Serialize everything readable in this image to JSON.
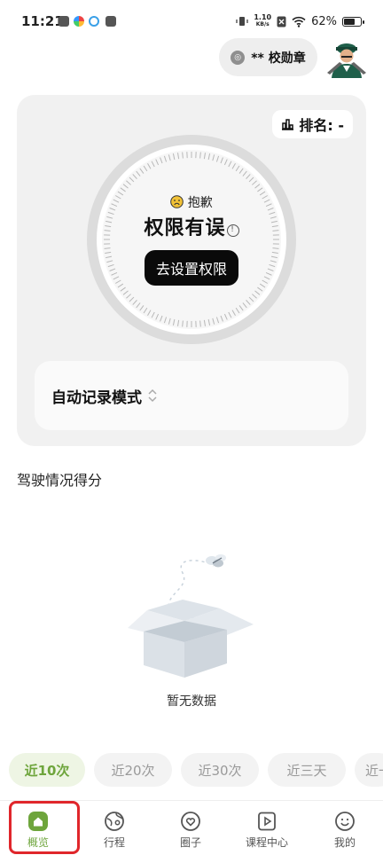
{
  "status_bar": {
    "time": "11:21",
    "net_speed_value": "1.10",
    "net_speed_unit": "KB/s",
    "battery": "62%",
    "battery_level": 0.62
  },
  "header": {
    "badge_label": "** 校勋章",
    "badge_icon": "medal-icon",
    "avatar_icon": "avatar-icon"
  },
  "card": {
    "rank_label": "排名: -",
    "rank_icon": "bar-chart-icon",
    "sorry_text": "抱歉",
    "headline": "权限有误",
    "info_glyph": "!",
    "permission_button": "去设置权限",
    "mode_label": "自动记录模式"
  },
  "section": {
    "title": "驾驶情况得分",
    "empty_text": "暂无数据"
  },
  "filters": [
    "近10次",
    "近20次",
    "近30次",
    "近三天",
    "近一"
  ],
  "active_filter": 0,
  "nav": {
    "items": [
      "概览",
      "行程",
      "圈子",
      "课程中心",
      "我的"
    ],
    "active": 0
  },
  "colors": {
    "accent": "#6ea53c",
    "highlight": "#e0262b"
  }
}
